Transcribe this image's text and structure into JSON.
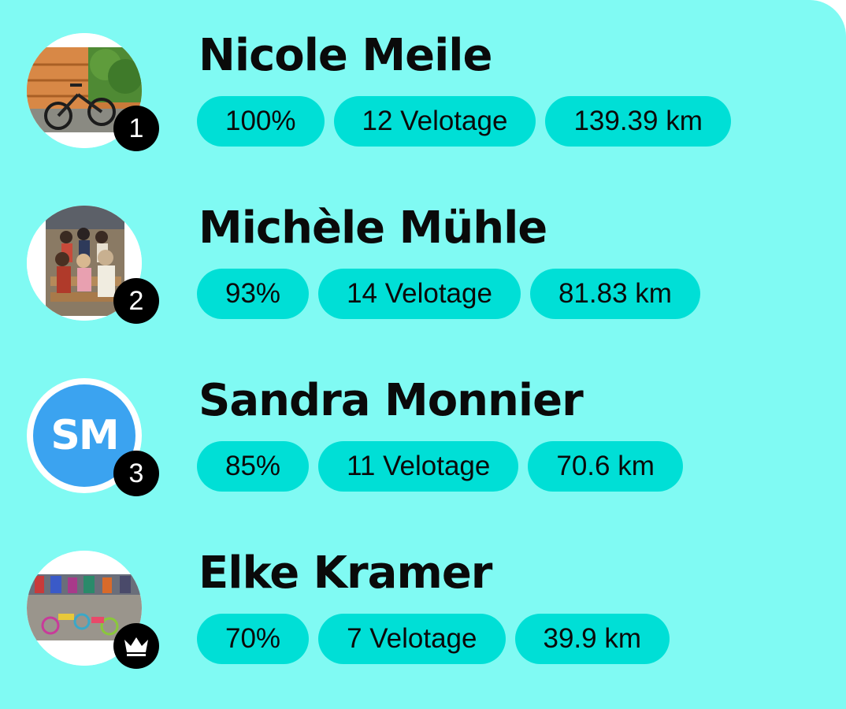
{
  "leaderboard": {
    "entries": [
      {
        "name": "Nicole Meile",
        "rank": "1",
        "avatar": "photo",
        "percent": "100%",
        "days": "12 Velotage",
        "distance": "139.39 km"
      },
      {
        "name": "Michèle Mühle",
        "rank": "2",
        "avatar": "photo",
        "percent": "93%",
        "days": "14 Velotage",
        "distance": "81.83 km"
      },
      {
        "name": "Sandra Monnier",
        "rank": "3",
        "avatar": "initials",
        "initials": "SM",
        "percent": "85%",
        "days": "11 Velotage",
        "distance": "70.6 km"
      },
      {
        "name": "Elke Kramer",
        "rank_icon": "crown-icon",
        "avatar": "photo",
        "percent": "70%",
        "days": "7 Velotage",
        "distance": "39.9 km"
      }
    ]
  },
  "colors": {
    "background": "#80faf3",
    "pill": "#00dfd6",
    "badge": "#000000",
    "initials_avatar": "#3ba3f0"
  }
}
